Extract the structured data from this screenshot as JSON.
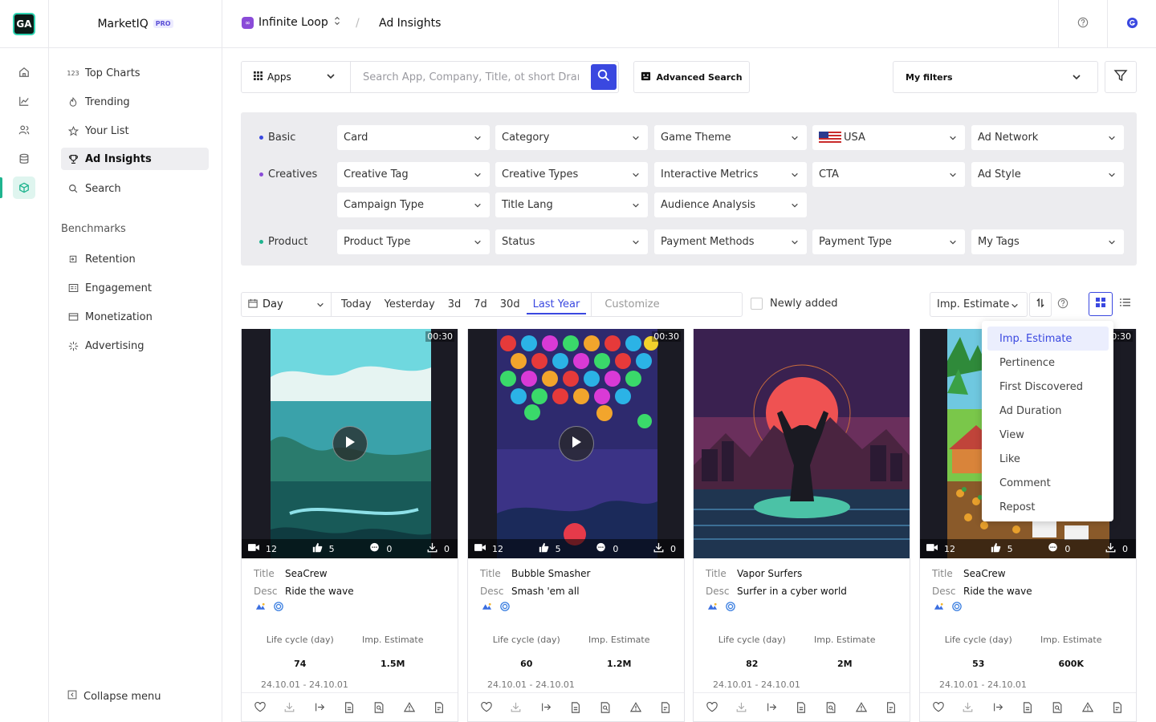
{
  "app": {
    "logo": "GA",
    "name": "MarketIQ",
    "badge": "PRO"
  },
  "rail_icons": [
    "home-icon",
    "chart-icon",
    "users-icon",
    "database-icon",
    "cube-icon"
  ],
  "sidebar": {
    "items": [
      {
        "label": "Top Charts",
        "icon": "123"
      },
      {
        "label": "Trending",
        "icon": "flame-icon"
      },
      {
        "label": "Your List",
        "icon": "star-icon"
      },
      {
        "label": "Ad Insights",
        "icon": "trophy-icon",
        "active": true
      },
      {
        "label": "Search",
        "icon": "search-icon"
      }
    ],
    "section": "Benchmarks",
    "bench": [
      {
        "label": "Retention"
      },
      {
        "label": "Engagement"
      },
      {
        "label": "Monetization"
      },
      {
        "label": "Advertising"
      }
    ],
    "collapse": "Collapse menu"
  },
  "header": {
    "workspace": "Infinite Loop",
    "sep": "/",
    "page": "Ad Insights"
  },
  "search": {
    "scope": "Apps",
    "placeholder": "Search App, Company, Title, ot short Drama",
    "advanced": "Advanced Search",
    "my_filters": "My filters"
  },
  "filters": {
    "basic_label": "Basic",
    "creatives_label": "Creatives",
    "product_label": "Product",
    "basic": [
      "Card",
      "Category",
      "Game Theme",
      "USA",
      "Ad Network"
    ],
    "creatives1": [
      "Creative Tag",
      "Creative Types",
      "Interactive Metrics",
      "CTA",
      "Ad Style"
    ],
    "creatives2": [
      "Campaign Type",
      "Title Lang",
      "Audience Analysis"
    ],
    "product": [
      "Product Type",
      "Status",
      "Payment Methods",
      "Payment Type",
      "My Tags"
    ],
    "colors": {
      "basic": "#3a48e0",
      "creatives": "#8a4bd8",
      "product": "#1fb48f"
    }
  },
  "dates": {
    "granularity": "Day",
    "options": [
      "Today",
      "Yesterday",
      "3d",
      "7d",
      "30d",
      "Last Year"
    ],
    "active": "Last Year",
    "customize": "Customize",
    "newly_added": "Newly added"
  },
  "sort": {
    "selected": "Imp. Estimate",
    "options": [
      "Imp. Estimate",
      "Pertinence",
      "First Discovered",
      "Ad Duration",
      "View",
      "Like",
      "Comment",
      "Repost"
    ]
  },
  "cards": [
    {
      "duration": "00:30",
      "videos": "12",
      "likes": "5",
      "comments": "0",
      "downloads": "0",
      "title": "SeaCrew",
      "desc": "Ride the wave",
      "life_cycle": "74",
      "imp": "1.5M",
      "range": "24.10.01 - 24.10.01"
    },
    {
      "duration": "00:30",
      "videos": "12",
      "likes": "5",
      "comments": "0",
      "downloads": "0",
      "title": "Bubble Smasher",
      "desc": "Smash 'em all",
      "life_cycle": "60",
      "imp": "1.2M",
      "range": "24.10.01 - 24.10.01"
    },
    {
      "duration": "",
      "videos": "",
      "likes": "",
      "comments": "",
      "downloads": "",
      "title": "Vapor Surfers",
      "desc": "Surfer in a cyber world",
      "life_cycle": "82",
      "imp": "2M",
      "range": "24.10.01 - 24.10.01"
    },
    {
      "duration": "00:30",
      "videos": "12",
      "likes": "5",
      "comments": "0",
      "downloads": "0",
      "title": "SeaCrew",
      "desc": "Ride the wave",
      "life_cycle": "53",
      "imp": "600K",
      "range": "24.10.01 - 24.10.01"
    }
  ],
  "card_labels": {
    "title": "Title",
    "desc": "Desc",
    "life": "Life cycle (day)",
    "imp": "Imp. Estimate"
  }
}
